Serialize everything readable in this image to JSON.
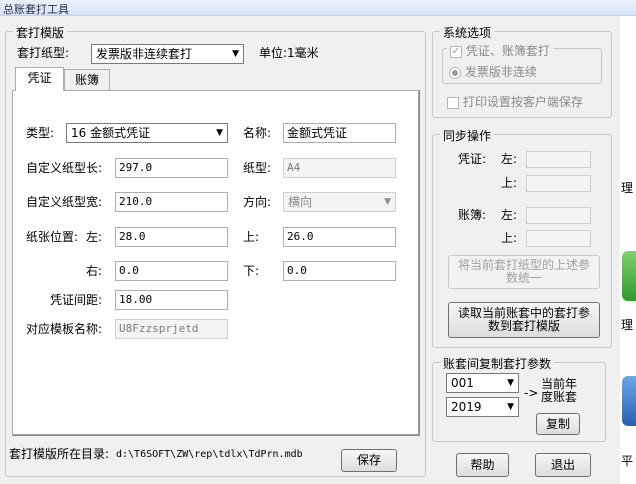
{
  "window": {
    "title": "总账套打工具"
  },
  "template_group": {
    "title": "套打模版",
    "paper_type_label": "套打纸型:",
    "paper_type_value": "发票版非连续套打",
    "unit_label": "单位:1毫米",
    "tabs": [
      {
        "label": "凭证"
      },
      {
        "label": "账簿"
      }
    ],
    "fields": {
      "type_label": "类型:",
      "type_value": "16 金额式凭证",
      "name_label": "名称:",
      "name_value": "金额式凭证",
      "paper_length_label": "自定义纸型长:",
      "paper_length_value": "297.0",
      "paper_kind_label": "纸型:",
      "paper_kind_value": "A4",
      "paper_width_label": "自定义纸型宽:",
      "paper_width_value": "210.0",
      "direction_label": "方向:",
      "direction_value": "横向",
      "pos_label": "纸张位置:",
      "left_label": "左:",
      "left_value": "28.0",
      "top_label": "上:",
      "top_value": "26.0",
      "right_label": "右:",
      "right_value": "0.0",
      "bottom_label": "下:",
      "bottom_value": "0.0",
      "spacing_label": "凭证间距:",
      "spacing_value": "18.00",
      "template_name_label": "对应模板名称:",
      "template_name_value": "U8Fzzsprjetd"
    },
    "dir_label": "套打模版所在目录:",
    "dir_value": "d:\\T6SOFT\\ZW\\rep\\tdlx\\TdPrn.mdb",
    "save_label": "保存"
  },
  "system_options": {
    "title": "系统选项",
    "voucher_ledger_label": "凭证、账簿套打",
    "invoice_label": "发票版非连续",
    "print_settings_label": "打印设置按客户端保存"
  },
  "sync": {
    "title": "同步操作",
    "voucher_label": "凭证:",
    "ledger_label": "账簿:",
    "left_label": "左:",
    "top_label": "上:",
    "unify_label": "将当前套打纸型的上述参数统一",
    "read_label": "读取当前账套中的套打参数到套打模版"
  },
  "copy": {
    "title": "账套间复制套打参数",
    "account_value": "001",
    "year_value": "2019",
    "arrow_text": "->",
    "target_label": "当前年度账套",
    "copy_label": "复制"
  },
  "footer": {
    "help_label": "帮助",
    "exit_label": "退出"
  },
  "background_edge": {
    "text1": "理",
    "text2": "理",
    "text3": "平"
  }
}
